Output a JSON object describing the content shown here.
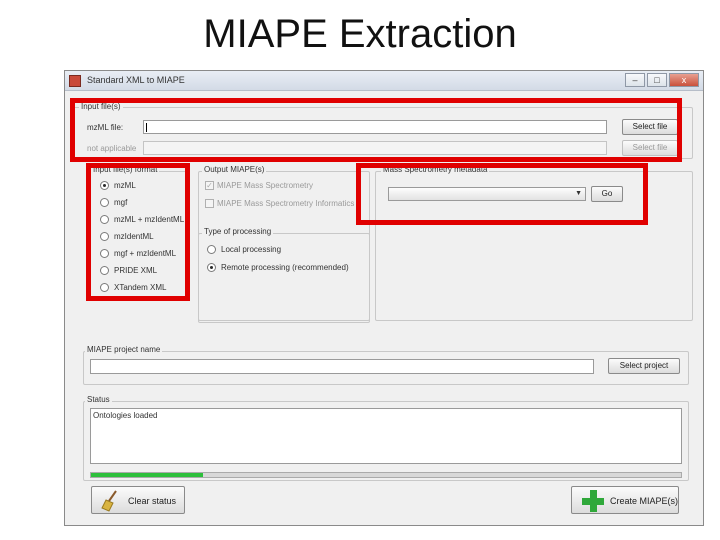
{
  "slide": {
    "title": "MIAPE Extraction"
  },
  "window": {
    "title": "Standard XML to MIAPE",
    "minimize": "–",
    "maximize": "□",
    "close": "x"
  },
  "input_files": {
    "group_label": "Input file(s)",
    "row1": {
      "label": "mzML file:",
      "value": "",
      "button": "Select file"
    },
    "row2": {
      "label": "not applicable",
      "value": "",
      "button": "Select file"
    }
  },
  "input_format": {
    "group_label": "Input file(s) format",
    "options": [
      "mzML",
      "mgf",
      "mzML + mzIdentML",
      "mzIdentML",
      "mgf + mzIdentML",
      "PRIDE XML",
      "XTandem XML"
    ],
    "selected": "mzML"
  },
  "output_miape": {
    "group_label": "Output MIAPE(s)",
    "options": [
      "MIAPE Mass Spectrometry",
      "MIAPE Mass Spectrometry Informatics"
    ]
  },
  "processing": {
    "group_label": "Type of processing",
    "options": [
      "Local processing",
      "Remote processing (recommended)"
    ],
    "selected": "Remote processing (recommended)"
  },
  "ms_metadata": {
    "group_label": "Mass Spectrometry metadata",
    "selected_value": "",
    "go_button": "Go"
  },
  "project": {
    "group_label": "MIAPE project name",
    "value": "",
    "button": "Select project"
  },
  "status": {
    "group_label": "Status",
    "text": "Ontologies loaded",
    "progress_fraction": 0.19
  },
  "actions": {
    "clear_status": "Clear status",
    "create_miape": "Create MIAPE(s)"
  },
  "colors": {
    "highlight": "#e00000",
    "progress": "#2dbf3b",
    "plus_icon": "#2fa83a"
  }
}
